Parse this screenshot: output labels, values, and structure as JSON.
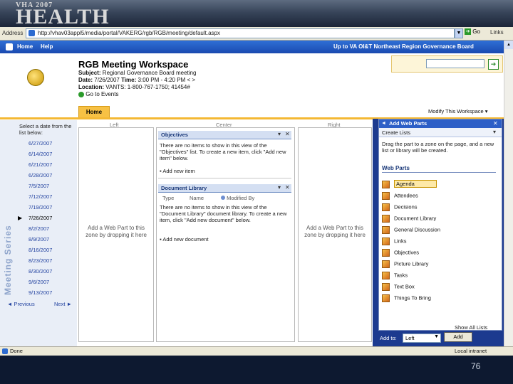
{
  "banner": {
    "logo_small": "VHA 2007",
    "logo_big": "HEALTH"
  },
  "browser": {
    "address_label": "Address",
    "url": "http://vhav03appl5/media/portal/VAKERG/rgb/RGB/meeting/default.aspx",
    "go_label": "Go",
    "links_label": "Links",
    "status_text": "Done",
    "zone_text": "Local intranet"
  },
  "nav": {
    "home": "Home",
    "help": "Help",
    "site_title": "Up to VA OI&T Northeast Region Governance Board"
  },
  "workspace": {
    "title": "RGB Meeting Workspace",
    "subject_label": "Subject:",
    "subject_value": "Regional Governance Board meeting",
    "date_label": "Date:",
    "date_value": "7/26/2007",
    "time_label": "Time:",
    "time_value": "3:00 PM - 4:20 PM",
    "time_nav": "< >",
    "location_label": "Location:",
    "location_value": "VANTS: 1-800-767-1750; 41454#",
    "goto_events": "Go to Events",
    "home_tab": "Home",
    "modify": "Modify This Workspace"
  },
  "series": {
    "vertical_title": "Meeting Series",
    "select_text": "Select a date from the list below:",
    "dates": [
      "6/27/2007",
      "6/14/2007",
      "6/21/2007",
      "6/28/2007",
      "7/5/2007",
      "7/12/2007",
      "7/19/2007",
      "7/26/2007",
      "8/2/2007",
      "8/9/2007",
      "8/16/2007",
      "8/23/2007",
      "8/30/2007",
      "9/6/2007",
      "9/13/2007"
    ],
    "selected_index": 7,
    "prev": "Previous",
    "next": "Next"
  },
  "zones": {
    "left": "Left",
    "center": "Center",
    "right": "Right",
    "hint_left": "Add a Web Part to this zone by dropping it here",
    "hint_right": "Add a Web Part to this zone by dropping it here"
  },
  "objectives": {
    "title": "Objectives",
    "empty": "There are no items to show in this view of the \"Objectives\" list. To create a new item, click \"Add new item\" below.",
    "add": "Add new item"
  },
  "doclib": {
    "title": "Document Library",
    "col_type": "Type",
    "col_name": "Name",
    "col_modified": "Modified By",
    "empty": "There are no items to show in this view of the \"Document Library\" document library. To create a new item, click \"Add new document\" below.",
    "add": "Add new document"
  },
  "toolpane": {
    "title": "Add Web Parts",
    "sub": "Create Lists",
    "desc": "Drag the part to a zone on the page, and a new list or library will be created.",
    "webparts_label": "Web Parts",
    "items": [
      "Agenda",
      "Attendees",
      "Decisions",
      "Document Library",
      "General Discussion",
      "Links",
      "Objectives",
      "Picture Library",
      "Tasks",
      "Text Box",
      "Things To Bring"
    ],
    "selected_item": "Agenda",
    "show_all": "Show All Lists",
    "add_to_label": "Add to:",
    "add_to_value": "Left",
    "add_button": "Add"
  },
  "slide": {
    "page_number": "76"
  }
}
